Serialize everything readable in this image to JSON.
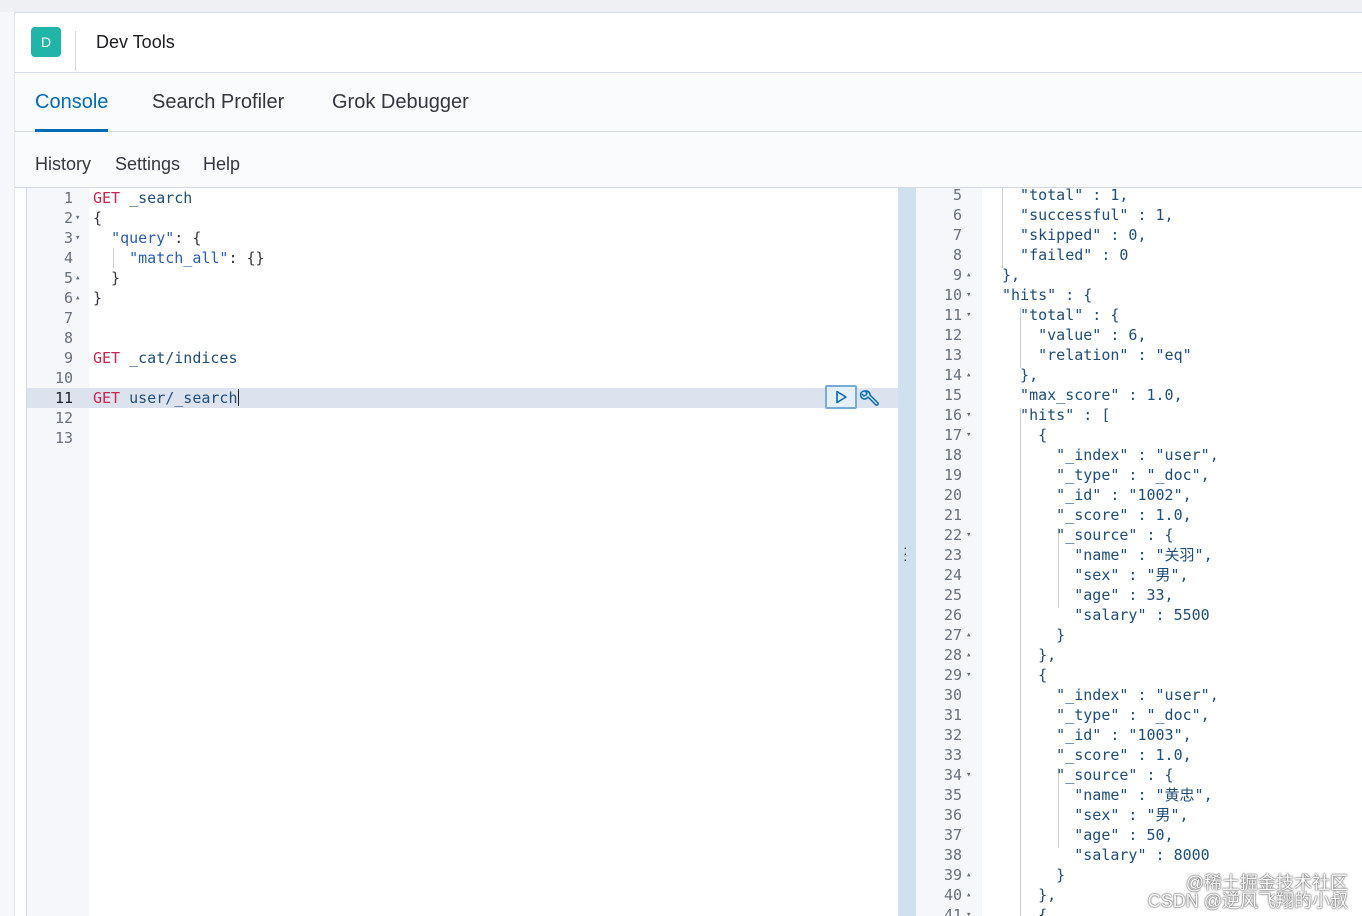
{
  "app": {
    "avatar_letter": "D",
    "title": "Dev Tools"
  },
  "tabs": [
    {
      "label": "Console",
      "active": true
    },
    {
      "label": "Search Profiler",
      "active": false
    },
    {
      "label": "Grok Debugger",
      "active": false
    }
  ],
  "menu": {
    "history": "History",
    "settings": "Settings",
    "help": "Help"
  },
  "request_lines": [
    {
      "n": "1",
      "fold": "",
      "html": "<span class=\"kw\">GET</span> <span class=\"path\">_search</span>"
    },
    {
      "n": "2",
      "fold": "▾",
      "html": "{"
    },
    {
      "n": "3",
      "fold": "▾",
      "html": "  <span class=\"str\">\"query\"</span>: {"
    },
    {
      "n": "4",
      "fold": "",
      "html": "    <span class=\"str\">\"match_all\"</span>: {}"
    },
    {
      "n": "5",
      "fold": "▴",
      "html": "  }"
    },
    {
      "n": "6",
      "fold": "▴",
      "html": "}"
    },
    {
      "n": "7",
      "fold": "",
      "html": ""
    },
    {
      "n": "8",
      "fold": "",
      "html": ""
    },
    {
      "n": "9",
      "fold": "",
      "html": "<span class=\"kw\">GET</span> <span class=\"path\">_cat/indices</span>"
    },
    {
      "n": "10",
      "fold": "",
      "html": ""
    },
    {
      "n": "11",
      "fold": "",
      "html": "<span class=\"kw\">GET</span> <span class=\"path\">user/_search</span><span class=\"cursor\"></span>",
      "active": true
    },
    {
      "n": "12",
      "fold": "",
      "html": ""
    },
    {
      "n": "13",
      "fold": "",
      "html": ""
    }
  ],
  "response_lines": [
    {
      "n": "5",
      "fold": "",
      "text": "    \"total\" : 1,"
    },
    {
      "n": "6",
      "fold": "",
      "text": "    \"successful\" : 1,"
    },
    {
      "n": "7",
      "fold": "",
      "text": "    \"skipped\" : 0,"
    },
    {
      "n": "8",
      "fold": "",
      "text": "    \"failed\" : 0"
    },
    {
      "n": "9",
      "fold": "▴",
      "text": "  },"
    },
    {
      "n": "10",
      "fold": "▾",
      "text": "  \"hits\" : {"
    },
    {
      "n": "11",
      "fold": "▾",
      "text": "    \"total\" : {"
    },
    {
      "n": "12",
      "fold": "",
      "text": "      \"value\" : 6,"
    },
    {
      "n": "13",
      "fold": "",
      "text": "      \"relation\" : \"eq\""
    },
    {
      "n": "14",
      "fold": "▴",
      "text": "    },"
    },
    {
      "n": "15",
      "fold": "",
      "text": "    \"max_score\" : 1.0,"
    },
    {
      "n": "16",
      "fold": "▾",
      "text": "    \"hits\" : ["
    },
    {
      "n": "17",
      "fold": "▾",
      "text": "      {"
    },
    {
      "n": "18",
      "fold": "",
      "text": "        \"_index\" : \"user\","
    },
    {
      "n": "19",
      "fold": "",
      "text": "        \"_type\" : \"_doc\","
    },
    {
      "n": "20",
      "fold": "",
      "text": "        \"_id\" : \"1002\","
    },
    {
      "n": "21",
      "fold": "",
      "text": "        \"_score\" : 1.0,"
    },
    {
      "n": "22",
      "fold": "▾",
      "text": "        \"_source\" : {"
    },
    {
      "n": "23",
      "fold": "",
      "text": "          \"name\" : \"关羽\","
    },
    {
      "n": "24",
      "fold": "",
      "text": "          \"sex\" : \"男\","
    },
    {
      "n": "25",
      "fold": "",
      "text": "          \"age\" : 33,"
    },
    {
      "n": "26",
      "fold": "",
      "text": "          \"salary\" : 5500"
    },
    {
      "n": "27",
      "fold": "▴",
      "text": "        }"
    },
    {
      "n": "28",
      "fold": "▴",
      "text": "      },"
    },
    {
      "n": "29",
      "fold": "▾",
      "text": "      {"
    },
    {
      "n": "30",
      "fold": "",
      "text": "        \"_index\" : \"user\","
    },
    {
      "n": "31",
      "fold": "",
      "text": "        \"_type\" : \"_doc\","
    },
    {
      "n": "32",
      "fold": "",
      "text": "        \"_id\" : \"1003\","
    },
    {
      "n": "33",
      "fold": "",
      "text": "        \"_score\" : 1.0,"
    },
    {
      "n": "34",
      "fold": "▾",
      "text": "        \"_source\" : {"
    },
    {
      "n": "35",
      "fold": "",
      "text": "          \"name\" : \"黄忠\","
    },
    {
      "n": "36",
      "fold": "",
      "text": "          \"sex\" : \"男\","
    },
    {
      "n": "37",
      "fold": "",
      "text": "          \"age\" : 50,"
    },
    {
      "n": "38",
      "fold": "",
      "text": "          \"salary\" : 8000"
    },
    {
      "n": "39",
      "fold": "▴",
      "text": "        }"
    },
    {
      "n": "40",
      "fold": "▴",
      "text": "      },"
    },
    {
      "n": "41",
      "fold": "▾",
      "text": "      {"
    }
  ],
  "watermark": {
    "line1": "@稀土掘金技术社区",
    "line2": "CSDN @逆风飞翔的小叔"
  },
  "colors": {
    "accent": "#006bb8",
    "avatar": "#20b5a8",
    "method": "#c7254e",
    "string": "#2a5db0"
  }
}
